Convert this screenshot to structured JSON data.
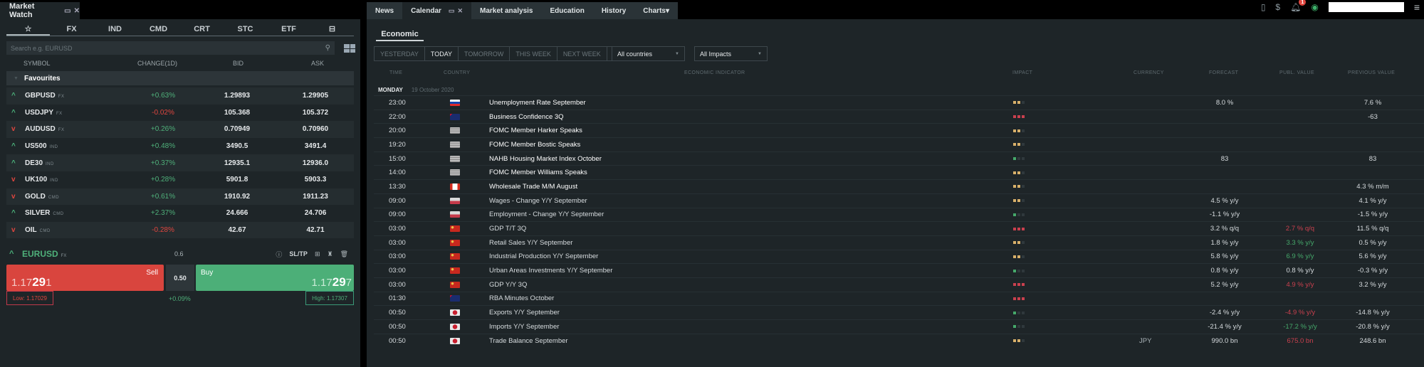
{
  "market_watch": {
    "title": "Market Watch",
    "categories": [
      "☆",
      "FX",
      "IND",
      "CMD",
      "CRT",
      "STC",
      "ETF"
    ],
    "search_placeholder": "Search e.g. EURUSD",
    "columns": {
      "symbol": "SYMBOL",
      "change": "CHANGE(1D)",
      "bid": "BID",
      "ask": "ASK"
    },
    "group": "Favourites",
    "rows": [
      {
        "dir": "up",
        "symbol": "GBPUSD",
        "type": "FX",
        "change": "+0.63%",
        "sign": "pos",
        "bid": "1.29893",
        "ask": "1.29905"
      },
      {
        "dir": "up",
        "symbol": "USDJPY",
        "type": "FX",
        "change": "-0.02%",
        "sign": "neg",
        "bid": "105.368",
        "ask": "105.372"
      },
      {
        "dir": "down",
        "symbol": "AUDUSD",
        "type": "FX",
        "change": "+0.26%",
        "sign": "pos",
        "bid": "0.70949",
        "ask": "0.70960"
      },
      {
        "dir": "up",
        "symbol": "US500",
        "type": "IND",
        "change": "+0.48%",
        "sign": "pos",
        "bid": "3490.5",
        "ask": "3491.4"
      },
      {
        "dir": "up",
        "symbol": "DE30",
        "type": "IND",
        "change": "+0.37%",
        "sign": "pos",
        "bid": "12935.1",
        "ask": "12936.0"
      },
      {
        "dir": "down",
        "symbol": "UK100",
        "type": "IND",
        "change": "+0.28%",
        "sign": "pos",
        "bid": "5901.8",
        "ask": "5903.3"
      },
      {
        "dir": "down",
        "symbol": "GOLD",
        "type": "CMD",
        "change": "+0.61%",
        "sign": "pos",
        "bid": "1910.92",
        "ask": "1911.23"
      },
      {
        "dir": "up",
        "symbol": "SILVER",
        "type": "CMD",
        "change": "+2.37%",
        "sign": "pos",
        "bid": "24.666",
        "ask": "24.706"
      },
      {
        "dir": "down",
        "symbol": "OIL",
        "type": "CMD",
        "change": "-0.28%",
        "sign": "neg",
        "bid": "42.67",
        "ask": "42.71"
      }
    ],
    "trade": {
      "symbol": "EURUSD",
      "type": "FX",
      "spread": "0.6",
      "sltp_label": "SL/TP",
      "sell_label": "Sell",
      "sell_price_prefix": "1.17",
      "sell_price_big": "29",
      "sell_price_suffix": "1",
      "volume": "0.50",
      "buy_label": "Buy",
      "buy_price_prefix": "1.17",
      "buy_price_big": "29",
      "buy_price_suffix": "7",
      "low": "Low: 1.17029",
      "high": "High: 1.17307",
      "daily_change": "+0.09%"
    }
  },
  "top_tabs": [
    {
      "label": "News",
      "active": false
    },
    {
      "label": "Calendar",
      "active": true
    },
    {
      "label": "Market analysis",
      "active": false
    },
    {
      "label": "Education",
      "active": false
    },
    {
      "label": "History",
      "active": false
    },
    {
      "label": "Charts▾",
      "active": false
    }
  ],
  "top_right": {
    "notification_count": "1"
  },
  "calendar": {
    "sub_tab": "Economic",
    "date_filters": [
      "YESTERDAY",
      "TODAY",
      "TOMORROW",
      "THIS WEEK",
      "NEXT WEEK"
    ],
    "active_filter": "TODAY",
    "country_select": "All countries",
    "impact_select": "All Impacts",
    "columns": {
      "time": "TIME",
      "country": "COUNTRY",
      "indicator": "ECONOMIC INDICATOR",
      "impact": "IMPACT",
      "currency": "CURRENCY",
      "forecast": "FORECAST",
      "publ_value": "PUBL. VALUE",
      "previous": "PREVIOUS VALUE"
    },
    "day_label": "MONDAY",
    "day_date": "19 October 2020",
    "impact_colors": {
      "high": "#c9404e",
      "medium": "#d8b06a",
      "low": "#45a86a",
      "off": "#2f383c"
    },
    "events": [
      {
        "time": "23:00",
        "country": "SK",
        "indicator": "Unemployment Rate September",
        "impact": "medium",
        "currency": "",
        "forecast": "8.0 %",
        "publ": "",
        "publ_color": "neutral",
        "previous": "7.6 %",
        "bold": true
      },
      {
        "time": "22:00",
        "country": "NZ",
        "indicator": "Business Confidence 3Q",
        "impact": "high",
        "currency": "",
        "forecast": "",
        "publ": "",
        "publ_color": "neutral",
        "previous": "-63",
        "bold": true
      },
      {
        "time": "20:00",
        "country": "US",
        "indicator": "FOMC Member Harker Speaks",
        "impact": "medium",
        "currency": "",
        "forecast": "",
        "publ": "",
        "publ_color": "neutral",
        "previous": "",
        "bold": true
      },
      {
        "time": "19:20",
        "country": "US",
        "indicator": "FOMC Member Bostic Speaks",
        "impact": "medium",
        "currency": "",
        "forecast": "",
        "publ": "",
        "publ_color": "neutral",
        "previous": "",
        "bold": true
      },
      {
        "time": "15:00",
        "country": "US",
        "indicator": "NAHB Housing Market Index October",
        "impact": "low",
        "currency": "",
        "forecast": "83",
        "publ": "",
        "publ_color": "neutral",
        "previous": "83",
        "bold": true
      },
      {
        "time": "14:00",
        "country": "US",
        "indicator": "FOMC Member Williams Speaks",
        "impact": "medium",
        "currency": "",
        "forecast": "",
        "publ": "",
        "publ_color": "neutral",
        "previous": "",
        "bold": true
      },
      {
        "time": "13:30",
        "country": "CA",
        "indicator": "Wholesale Trade M/M August",
        "impact": "medium",
        "currency": "",
        "forecast": "",
        "publ": "",
        "publ_color": "neutral",
        "previous": "4.3 % m/m",
        "bold": true
      },
      {
        "time": "09:00",
        "country": "PL",
        "indicator": "Wages - Change Y/Y September",
        "impact": "medium",
        "currency": "",
        "forecast": "4.5 % y/y",
        "publ": "",
        "publ_color": "neutral",
        "previous": "4.1 % y/y",
        "bold": false
      },
      {
        "time": "09:00",
        "country": "PL",
        "indicator": "Employment - Change Y/Y September",
        "impact": "low",
        "currency": "",
        "forecast": "-1.1 % y/y",
        "publ": "",
        "publ_color": "neutral",
        "previous": "-1.5 % y/y",
        "bold": false
      },
      {
        "time": "03:00",
        "country": "CN",
        "indicator": "GDP T/T 3Q",
        "impact": "high",
        "currency": "",
        "forecast": "3.2 % q/q",
        "publ": "2.7 % q/q",
        "publ_color": "red",
        "previous": "11.5 % q/q",
        "bold": false
      },
      {
        "time": "03:00",
        "country": "CN",
        "indicator": "Retail Sales Y/Y September",
        "impact": "medium",
        "currency": "",
        "forecast": "1.8 % y/y",
        "publ": "3.3 % y/y",
        "publ_color": "green",
        "previous": "0.5 % y/y",
        "bold": false
      },
      {
        "time": "03:00",
        "country": "CN",
        "indicator": "Industrial Production Y/Y September",
        "impact": "medium",
        "currency": "",
        "forecast": "5.8 % y/y",
        "publ": "6.9 % y/y",
        "publ_color": "green",
        "previous": "5.6 % y/y",
        "bold": false
      },
      {
        "time": "03:00",
        "country": "CN",
        "indicator": "Urban Areas Investments Y/Y September",
        "impact": "low",
        "currency": "",
        "forecast": "0.8 % y/y",
        "publ": "0.8 % y/y",
        "publ_color": "neutral",
        "previous": "-0.3 % y/y",
        "bold": false
      },
      {
        "time": "03:00",
        "country": "CN",
        "indicator": "GDP Y/Y 3Q",
        "impact": "high",
        "currency": "",
        "forecast": "5.2 % y/y",
        "publ": "4.9 % y/y",
        "publ_color": "red",
        "previous": "3.2 % y/y",
        "bold": false
      },
      {
        "time": "01:30",
        "country": "AU",
        "indicator": "RBA Minutes October",
        "impact": "high",
        "currency": "",
        "forecast": "",
        "publ": "",
        "publ_color": "neutral",
        "previous": "",
        "bold": false
      },
      {
        "time": "00:50",
        "country": "JP",
        "indicator": "Exports Y/Y September",
        "impact": "low",
        "currency": "",
        "forecast": "-2.4 % y/y",
        "publ": "-4.9 % y/y",
        "publ_color": "red",
        "previous": "-14.8 % y/y",
        "bold": false
      },
      {
        "time": "00:50",
        "country": "JP",
        "indicator": "Imports Y/Y September",
        "impact": "low",
        "currency": "",
        "forecast": "-21.4 % y/y",
        "publ": "-17.2 % y/y",
        "publ_color": "green",
        "previous": "-20.8 % y/y",
        "bold": false
      },
      {
        "time": "00:50",
        "country": "JP",
        "indicator": "Trade Balance September",
        "impact": "medium",
        "currency": "JPY",
        "forecast": "990.0 bn",
        "publ": "675.0 bn",
        "publ_color": "red",
        "previous": "248.6 bn",
        "bold": false
      }
    ]
  }
}
